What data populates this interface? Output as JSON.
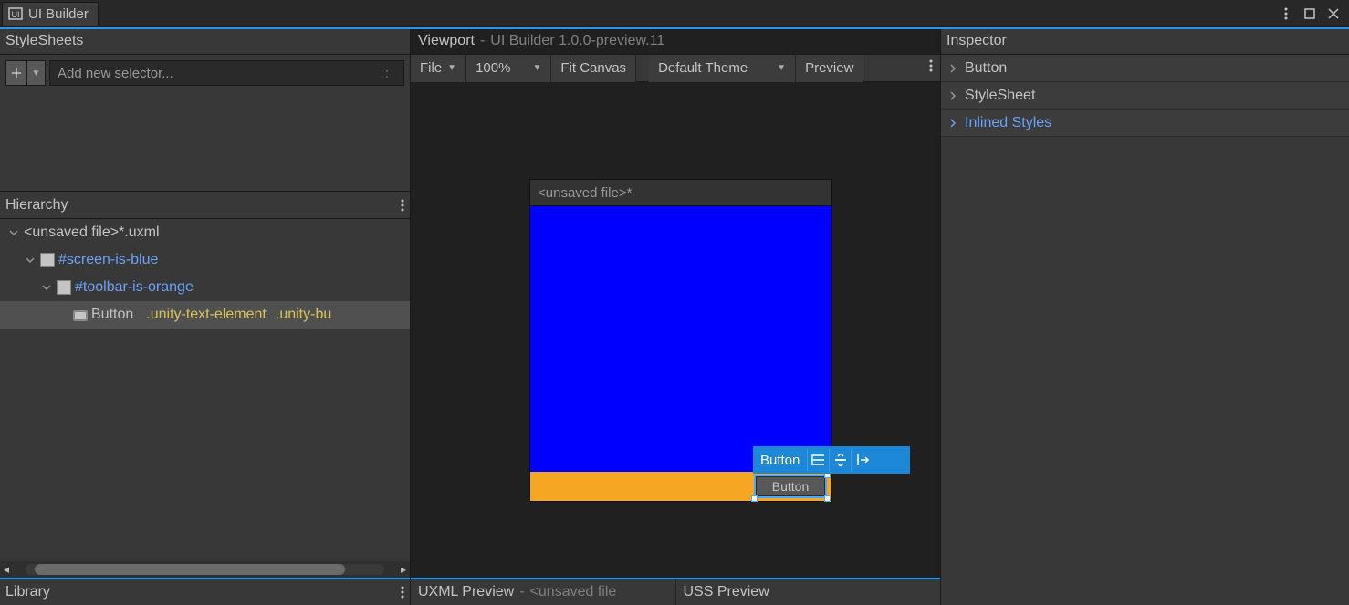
{
  "titlebar": {
    "tab_label": "UI Builder"
  },
  "stylesheets": {
    "header": "StyleSheets",
    "add_selector_placeholder": "Add new selector...",
    "colon_hint": ":"
  },
  "hierarchy": {
    "header": "Hierarchy",
    "root": "<unsaved file>*.uxml",
    "node_screen": "#screen-is-blue",
    "node_toolbar": "#toolbar-is-orange",
    "node_button_label": "Button",
    "node_button_class1": ".unity-text-element",
    "node_button_class2": ".unity-bu"
  },
  "library": {
    "header": "Library"
  },
  "viewport": {
    "header": "Viewport",
    "subtitle": "UI Builder 1.0.0-preview.11",
    "file_btn": "File",
    "zoom": "100%",
    "fit_btn": "Fit Canvas",
    "theme": "Default Theme",
    "preview_btn": "Preview",
    "canvas_title": "<unsaved file>*",
    "sel_label": "Button",
    "sel_button_text": "Button"
  },
  "preview_footer": {
    "uxml_label": "UXML Preview",
    "uxml_sub": "<unsaved file",
    "uss_label": "USS Preview"
  },
  "inspector": {
    "header": "Inspector",
    "item_button": "Button",
    "item_stylesheet": "StyleSheet",
    "item_inlined": "Inlined Styles"
  }
}
